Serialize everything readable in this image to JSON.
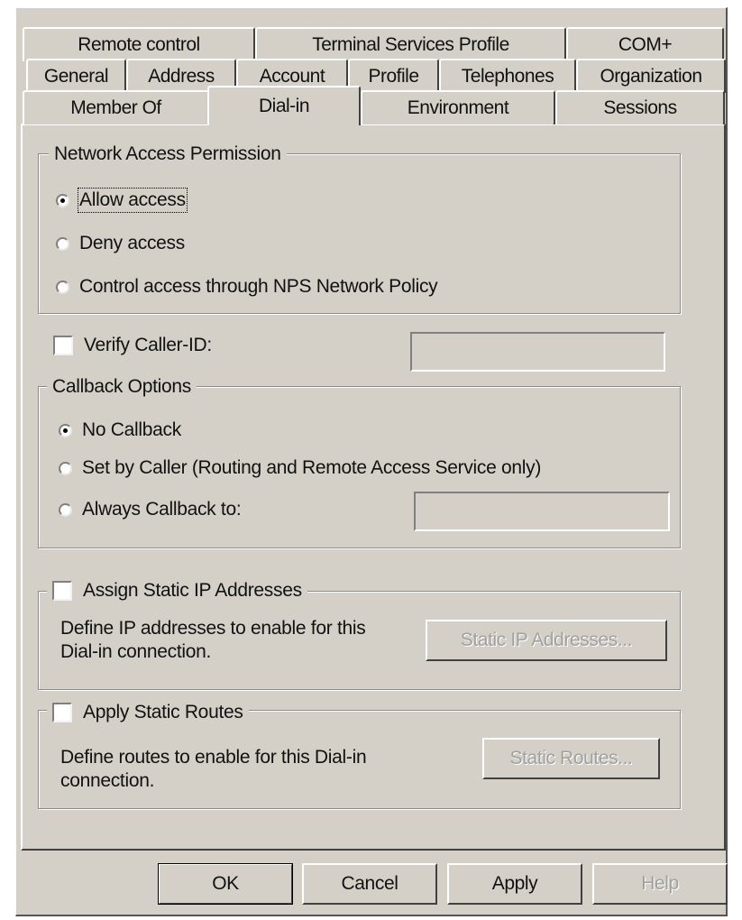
{
  "tabs": {
    "row1": [
      "Remote control",
      "Terminal Services Profile",
      "COM+"
    ],
    "row2": [
      "General",
      "Address",
      "Account",
      "Profile",
      "Telephones",
      "Organization"
    ],
    "row3": [
      "Member Of",
      "Dial-in",
      "Environment",
      "Sessions"
    ],
    "active": "Dial-in"
  },
  "network_access": {
    "legend": "Network Access Permission",
    "options": [
      {
        "label": "Allow access",
        "selected": true
      },
      {
        "label": "Deny access",
        "selected": false
      },
      {
        "label": "Control access through NPS Network Policy",
        "selected": false
      }
    ]
  },
  "verify_caller": {
    "label": "Verify Caller-ID:",
    "checked": false,
    "value": ""
  },
  "callback": {
    "legend": "Callback Options",
    "options": [
      {
        "label": "No Callback",
        "selected": true
      },
      {
        "label": "Set by Caller (Routing and Remote Access Service only)",
        "selected": false
      },
      {
        "label": "Always Callback to:",
        "selected": false
      }
    ],
    "number_value": ""
  },
  "static_ip": {
    "label": "Assign Static IP Addresses",
    "checked": false,
    "description": [
      "Define IP addresses to enable for this",
      "Dial-in connection."
    ],
    "button": "Static IP Addresses..."
  },
  "static_routes": {
    "label": "Apply Static Routes",
    "checked": false,
    "description": [
      "Define routes to enable for this Dial-in",
      "connection."
    ],
    "button": "Static Routes..."
  },
  "buttons": {
    "ok": "OK",
    "cancel": "Cancel",
    "apply": "Apply",
    "help": "Help"
  }
}
